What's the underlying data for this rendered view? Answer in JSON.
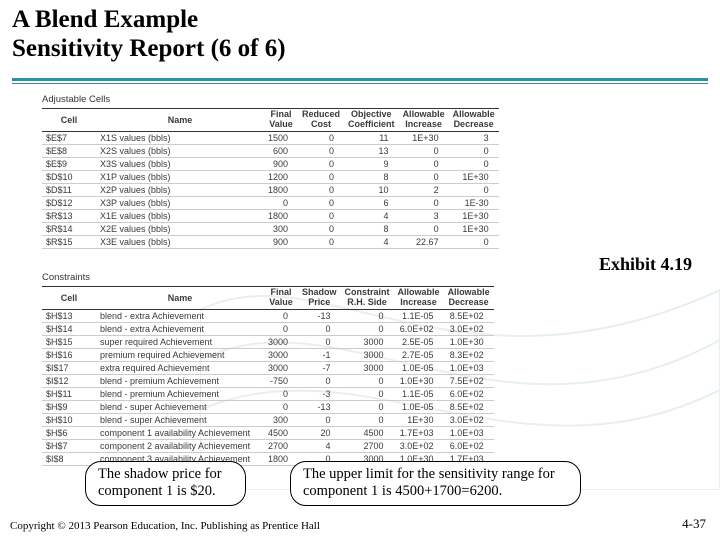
{
  "title_line1": "A Blend Example",
  "title_line2": "Sensitivity Report (6 of 6)",
  "exhibit": "Exhibit 4.19",
  "copyright": "Copyright © 2013 Pearson Education, Inc. Publishing as Prentice Hall",
  "pagenum": "4-37",
  "adj_label": "Adjustable Cells",
  "con_label": "Constraints",
  "headers": {
    "cell": "Cell",
    "name": "Name",
    "final_value": "Final\nValue",
    "reduced_cost": "Reduced\nCost",
    "obj_coef": "Objective\nCoefficient",
    "allow_inc": "Allowable\nIncrease",
    "allow_dec": "Allowable\nDecrease",
    "shadow_price": "Shadow\nPrice",
    "constraint_rhs": "Constraint\nR.H. Side"
  },
  "adj_rows": [
    {
      "cell": "$E$7",
      "name": "X1S values (bbls)",
      "fv": "1500",
      "rc": "0",
      "oc": "11",
      "ai": "1E+30",
      "ad": "3"
    },
    {
      "cell": "$E$8",
      "name": "X2S values (bbls)",
      "fv": "600",
      "rc": "0",
      "oc": "13",
      "ai": "0",
      "ad": "0"
    },
    {
      "cell": "$E$9",
      "name": "X3S values (bbls)",
      "fv": "900",
      "rc": "0",
      "oc": "9",
      "ai": "0",
      "ad": "0"
    },
    {
      "cell": "$D$10",
      "name": "X1P values (bbls)",
      "fv": "1200",
      "rc": "0",
      "oc": "8",
      "ai": "0",
      "ad": "1E+30"
    },
    {
      "cell": "$D$11",
      "name": "X2P values (bbls)",
      "fv": "1800",
      "rc": "0",
      "oc": "10",
      "ai": "2",
      "ad": "0"
    },
    {
      "cell": "$D$12",
      "name": "X3P values (bbls)",
      "fv": "0",
      "rc": "0",
      "oc": "6",
      "ai": "0",
      "ad": "1E-30"
    },
    {
      "cell": "$R$13",
      "name": "X1E values (bbls)",
      "fv": "1800",
      "rc": "0",
      "oc": "4",
      "ai": "3",
      "ad": "1E+30"
    },
    {
      "cell": "$R$14",
      "name": "X2E values (bbls)",
      "fv": "300",
      "rc": "0",
      "oc": "8",
      "ai": "0",
      "ad": "1E+30"
    },
    {
      "cell": "$R$15",
      "name": "X3E values (bbls)",
      "fv": "900",
      "rc": "0",
      "oc": "4",
      "ai": "22.67",
      "ad": "0"
    }
  ],
  "con_rows": [
    {
      "cell": "$H$13",
      "name": "blend - extra Achievement",
      "fv": "0",
      "sp": "-13",
      "rhs": "0",
      "ai": "1.1E-05",
      "ad": "8.5E+02"
    },
    {
      "cell": "$H$14",
      "name": "blend - extra Achievement",
      "fv": "0",
      "sp": "0",
      "rhs": "0",
      "ai": "6.0E+02",
      "ad": "3.0E+02"
    },
    {
      "cell": "$H$15",
      "name": "super required Achievement",
      "fv": "3000",
      "sp": "0",
      "rhs": "3000",
      "ai": "2.5E-05",
      "ad": "1.0E+30"
    },
    {
      "cell": "$H$16",
      "name": "premium required Achievement",
      "fv": "3000",
      "sp": "-1",
      "rhs": "3000",
      "ai": "2.7E-05",
      "ad": "8.3E+02"
    },
    {
      "cell": "$I$17",
      "name": "extra required Achievement",
      "fv": "3000",
      "sp": "-7",
      "rhs": "3000",
      "ai": "1.0E-05",
      "ad": "1.0E+03"
    },
    {
      "cell": "$I$12",
      "name": "blend - premium Achievement",
      "fv": "-750",
      "sp": "0",
      "rhs": "0",
      "ai": "1.0E+30",
      "ad": "7.5E+02"
    },
    {
      "cell": "$H$11",
      "name": "blend - premium Achievement",
      "fv": "0",
      "sp": "-3",
      "rhs": "0",
      "ai": "1.1E-05",
      "ad": "6.0E+02"
    },
    {
      "cell": "$H$9",
      "name": "blend - super Achievement",
      "fv": "0",
      "sp": "-13",
      "rhs": "0",
      "ai": "1.0E-05",
      "ad": "8.5E+02"
    },
    {
      "cell": "$H$10",
      "name": "blend - super Achievement",
      "fv": "300",
      "sp": "0",
      "rhs": "0",
      "ai": "1E+30",
      "ad": "3.0E+02"
    },
    {
      "cell": "$H$6",
      "name": "component 1 availability Achievement",
      "fv": "4500",
      "sp": "20",
      "rhs": "4500",
      "ai": "1.7E+03",
      "ad": "1.0E+03"
    },
    {
      "cell": "$H$7",
      "name": "component 2 availability Achievement",
      "fv": "2700",
      "sp": "4",
      "rhs": "2700",
      "ai": "3.0E+02",
      "ad": "6.0E+02"
    },
    {
      "cell": "$I$8",
      "name": "component 3 availability Achievement",
      "fv": "1800",
      "sp": "0",
      "rhs": "3000",
      "ai": "1.0E+30",
      "ad": "1.7E+03"
    }
  ],
  "callout1": "The shadow price for component 1 is $20.",
  "callout2": "The upper limit for the sensitivity range for component 1 is 4500+1700=6200."
}
